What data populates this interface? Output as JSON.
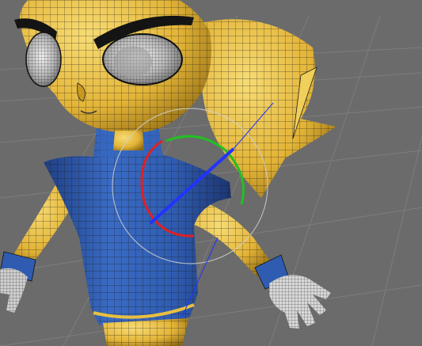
{
  "viewport": {
    "kind": "3d-viewport",
    "shading": "smooth-shaded-with-wireframe",
    "background_color": "#6b6b6b",
    "grid_color": "#7d7d7d",
    "grid_visible": true
  },
  "model": {
    "skin_color": "#e3b437",
    "skin_highlight": "#f7dc74",
    "skin_shadow": "#8f6a12",
    "shirt_color": "#2f5cb0",
    "shirt_highlight": "#5f8ee0",
    "glove_color": "#d8d8d8",
    "wire_color": "#1a1a1a"
  },
  "gizmo": {
    "type": "rotate-gizmo",
    "x_axis_color": "#e02020",
    "y_axis_color": "#22c022",
    "z_axis_color": "#2233ff",
    "outer_ring_color": "#d0d0d0"
  }
}
